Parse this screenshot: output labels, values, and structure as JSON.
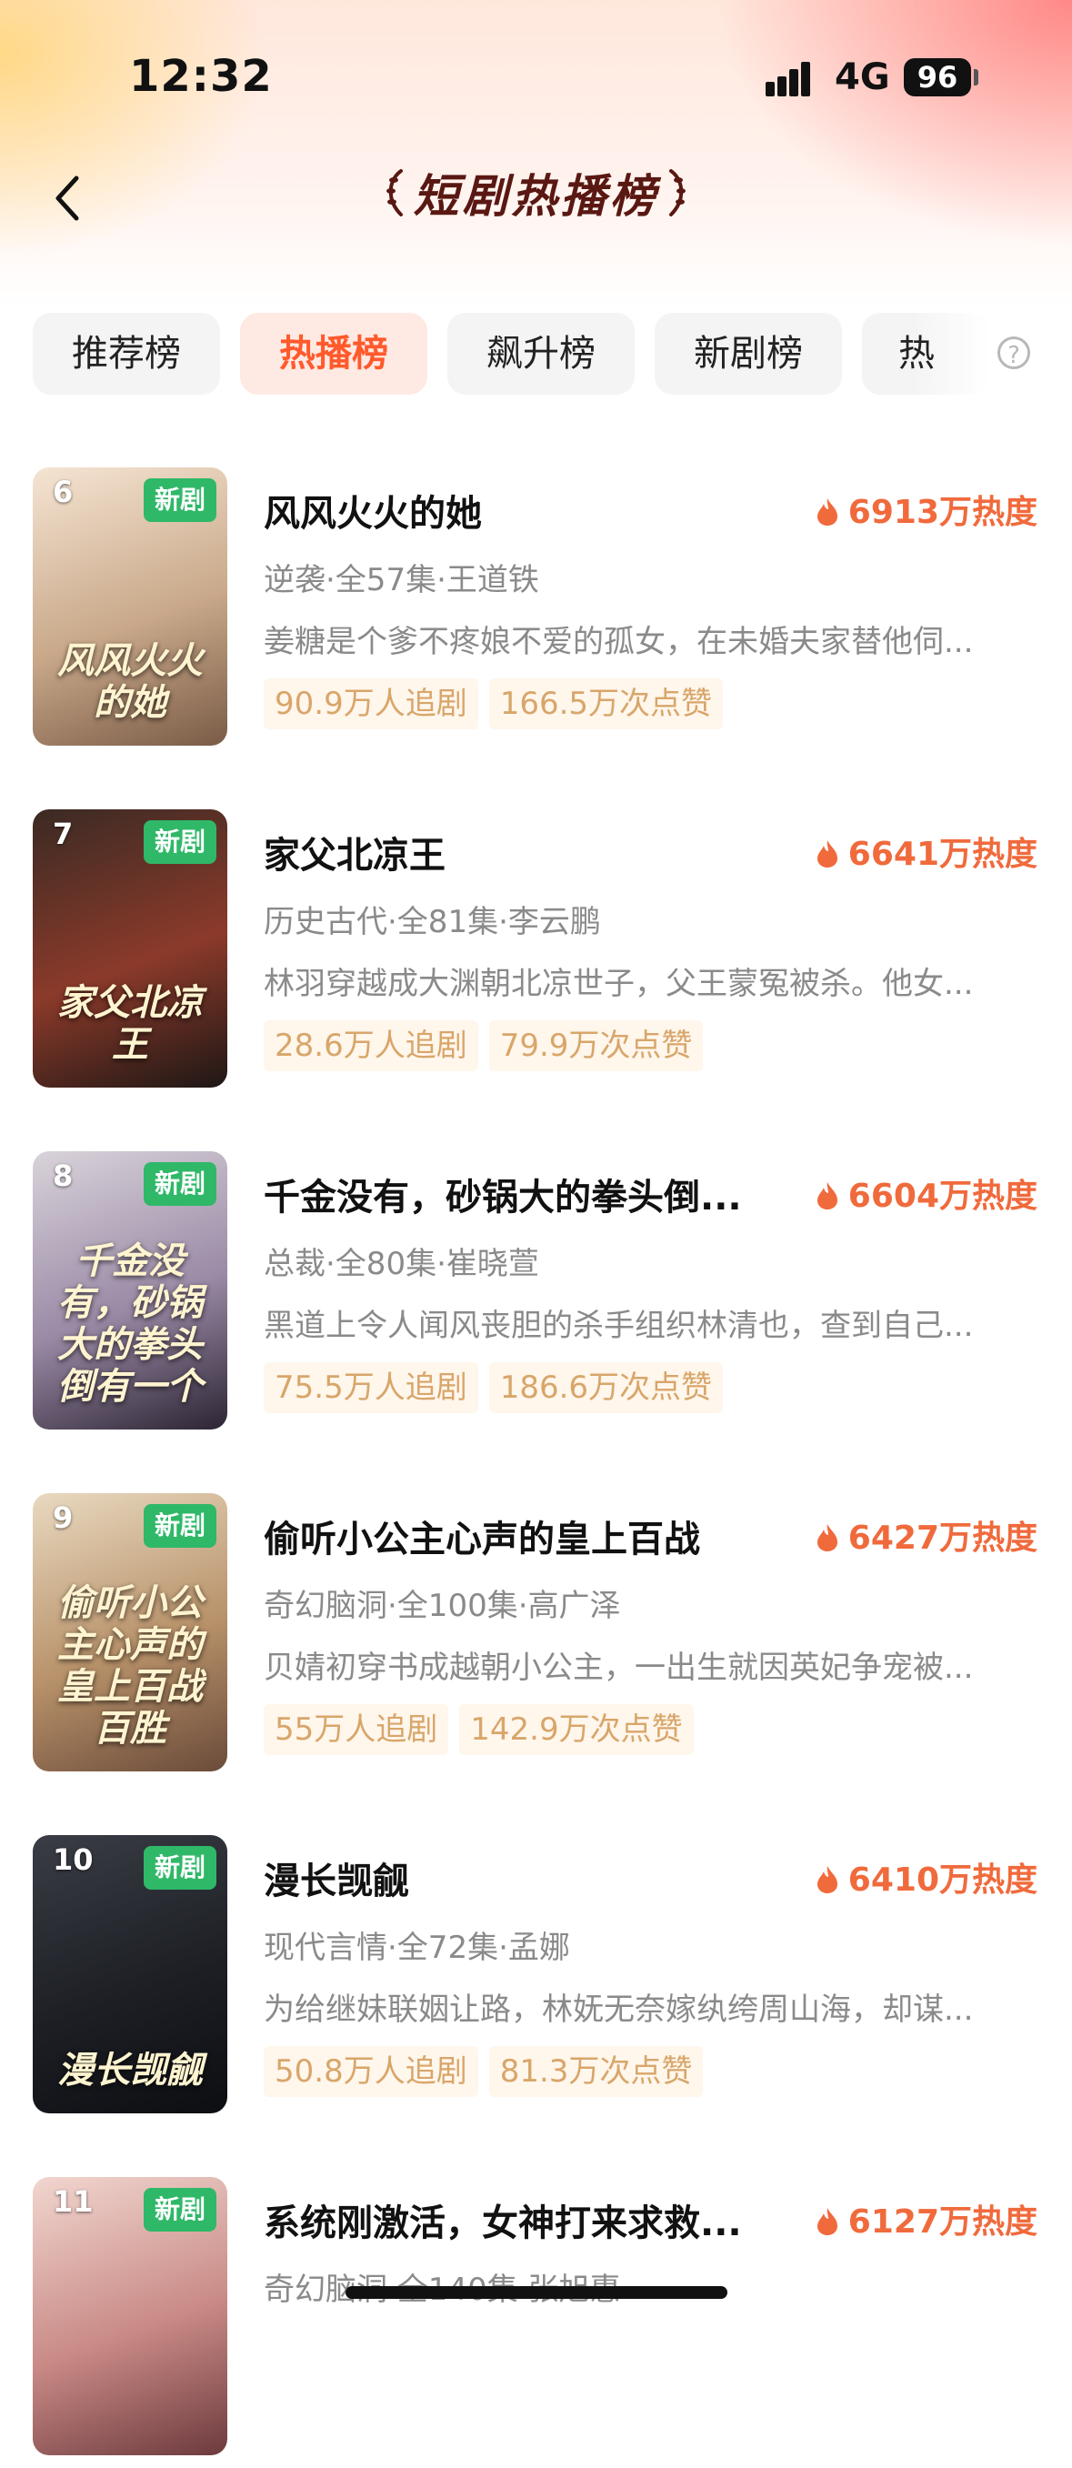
{
  "status_bar": {
    "time": "12:32",
    "network": "4G",
    "battery": "96"
  },
  "header": {
    "title": "短剧热播榜",
    "back_label": "返回"
  },
  "tabs": [
    {
      "label": "推荐榜",
      "active": false
    },
    {
      "label": "热播榜",
      "active": true
    },
    {
      "label": "飙升榜",
      "active": false
    },
    {
      "label": "新剧榜",
      "active": false
    },
    {
      "label": "热",
      "active": false
    }
  ],
  "help_label": "?",
  "items": [
    {
      "rank": "6",
      "badge": "新剧",
      "title": "风风火火的她",
      "heat": "6913万热度",
      "meta": "逆袭·全57集·王道铁",
      "desc": "姜糖是个爹不疼娘不爱的孤女，在未婚夫家替他伺...",
      "followers": "90.9万人追剧",
      "likes": "166.5万次点赞",
      "poster_text": "风风火火的她",
      "poster_colors": [
        "#f5e4d3",
        "#c9a98a",
        "#7a5b46"
      ]
    },
    {
      "rank": "7",
      "badge": "新剧",
      "title": "家父北凉王",
      "heat": "6641万热度",
      "meta": "历史古代·全81集·李云鹏",
      "desc": "林羽穿越成大渊朝北凉世子，父王蒙冤被杀。他女...",
      "followers": "28.6万人追剧",
      "likes": "79.9万次点赞",
      "poster_text": "家父北凉王",
      "poster_colors": [
        "#3a2a24",
        "#8b3a2a",
        "#1e1715"
      ]
    },
    {
      "rank": "8",
      "badge": "新剧",
      "title": "千金没有，砂锅大的拳头倒...",
      "heat": "6604万热度",
      "meta": "总裁·全80集·崔晓萱",
      "desc": "黑道上令人闻风丧胆的杀手组织林清也，查到自己...",
      "followers": "75.5万人追剧",
      "likes": "186.6万次点赞",
      "poster_text": "千金没有，砂锅大的拳头倒有一个",
      "poster_colors": [
        "#d9d3da",
        "#9a8aa6",
        "#2c2433"
      ]
    },
    {
      "rank": "9",
      "badge": "新剧",
      "title": "偷听小公主心声的皇上百战",
      "heat": "6427万热度",
      "meta": "奇幻脑洞·全100集·高广泽",
      "desc": "贝婧初穿书成越朝小公主，一出生就因英妃争宠被...",
      "followers": "55万人追剧",
      "likes": "142.9万次点赞",
      "poster_text": "偷听小公主心声的皇上百战百胜",
      "poster_colors": [
        "#e9d9c0",
        "#b8926a",
        "#6b4b3a"
      ]
    },
    {
      "rank": "10",
      "badge": "新剧",
      "title": "漫长觊觎",
      "heat": "6410万热度",
      "meta": "现代言情·全72集·孟娜",
      "desc": "为给继妹联姻让路，林妩无奈嫁纨绔周山海，却谋...",
      "followers": "50.8万人追剧",
      "likes": "81.3万次点赞",
      "poster_text": "漫长觊觎",
      "poster_colors": [
        "#3a3d45",
        "#1d1f25",
        "#0d0e12"
      ]
    },
    {
      "rank": "11",
      "badge": "新剧",
      "title": "系统刚激活，女神打来求救...",
      "heat": "6127万热度",
      "meta": "奇幻脑洞·全140集·张旭惠",
      "desc": "",
      "followers": "",
      "likes": "",
      "poster_text": "",
      "poster_colors": [
        "#f1d6cf",
        "#c98a86",
        "#6d3a3d"
      ]
    }
  ]
}
